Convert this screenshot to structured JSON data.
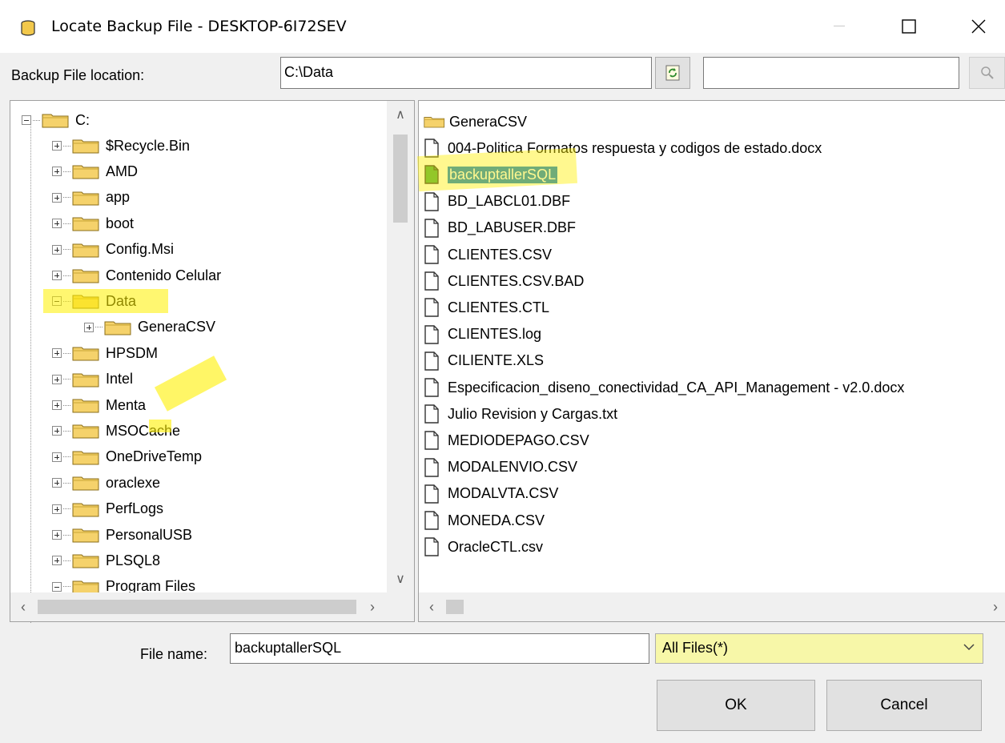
{
  "window": {
    "title": "Locate Backup File - DESKTOP-6I72SEV"
  },
  "location": {
    "label": "Backup File location:",
    "value": "C:\\Data",
    "search_value": ""
  },
  "tree": {
    "root_label": "C:",
    "items": [
      {
        "label": "$Recycle.Bin",
        "expanded": false
      },
      {
        "label": "AMD",
        "expanded": false
      },
      {
        "label": "app",
        "expanded": false
      },
      {
        "label": "boot",
        "expanded": false
      },
      {
        "label": "Config.Msi",
        "expanded": false
      },
      {
        "label": "Contenido Celular",
        "expanded": false
      },
      {
        "label": "Data",
        "expanded": true
      },
      {
        "label": "GeneraCSV",
        "expanded": false,
        "child": true
      },
      {
        "label": "HPSDM",
        "expanded": false
      },
      {
        "label": "Intel",
        "expanded": false
      },
      {
        "label": "Menta",
        "expanded": false
      },
      {
        "label": "MSOCache",
        "expanded": false
      },
      {
        "label": "OneDriveTemp",
        "expanded": false
      },
      {
        "label": "oraclexe",
        "expanded": false
      },
      {
        "label": "PerfLogs",
        "expanded": false
      },
      {
        "label": "PersonalUSB",
        "expanded": false
      },
      {
        "label": "PLSQL8",
        "expanded": false
      },
      {
        "label": "Program Files",
        "expanded": true
      }
    ]
  },
  "files": {
    "items": [
      {
        "label": "GeneraCSV",
        "type": "folder"
      },
      {
        "label": "004-Politica Formatos respuesta y codigos de estado.docx",
        "type": "file"
      },
      {
        "label": "backuptallerSQL",
        "type": "file",
        "selected": true
      },
      {
        "label": "BD_LABCL01.DBF",
        "type": "file"
      },
      {
        "label": "BD_LABUSER.DBF",
        "type": "file"
      },
      {
        "label": "CLIENTES.CSV",
        "type": "file"
      },
      {
        "label": "CLIENTES.CSV.BAD",
        "type": "file"
      },
      {
        "label": "CLIENTES.CTL",
        "type": "file"
      },
      {
        "label": "CLIENTES.log",
        "type": "file"
      },
      {
        "label": "CILIENTE.XLS",
        "type": "file"
      },
      {
        "label": "Especificacion_diseno_conectividad_CA_API_Management - v2.0.docx",
        "type": "file"
      },
      {
        "label": "Julio Revision y Cargas.txt",
        "type": "file"
      },
      {
        "label": "MEDIODEPAGO.CSV",
        "type": "file"
      },
      {
        "label": "MODALENVIO.CSV",
        "type": "file"
      },
      {
        "label": "MODALVTA.CSV",
        "type": "file"
      },
      {
        "label": "MONEDA.CSV",
        "type": "file"
      },
      {
        "label": "OracleCTL.csv",
        "type": "file"
      }
    ]
  },
  "bottom": {
    "file_name_label": "File name:",
    "file_name_value": "backuptallerSQL",
    "filter_value": "All Files(*)",
    "ok_label": "OK",
    "cancel_label": "Cancel"
  },
  "colors": {
    "selection": "#0078d7",
    "highlighter": "#fff000",
    "folder": "#f5d26b"
  },
  "icons": [
    "app-icon",
    "minimize-icon",
    "maximize-icon",
    "close-icon",
    "refresh-icon",
    "search-icon",
    "folder-icon",
    "file-icon",
    "chevron-down-icon"
  ]
}
